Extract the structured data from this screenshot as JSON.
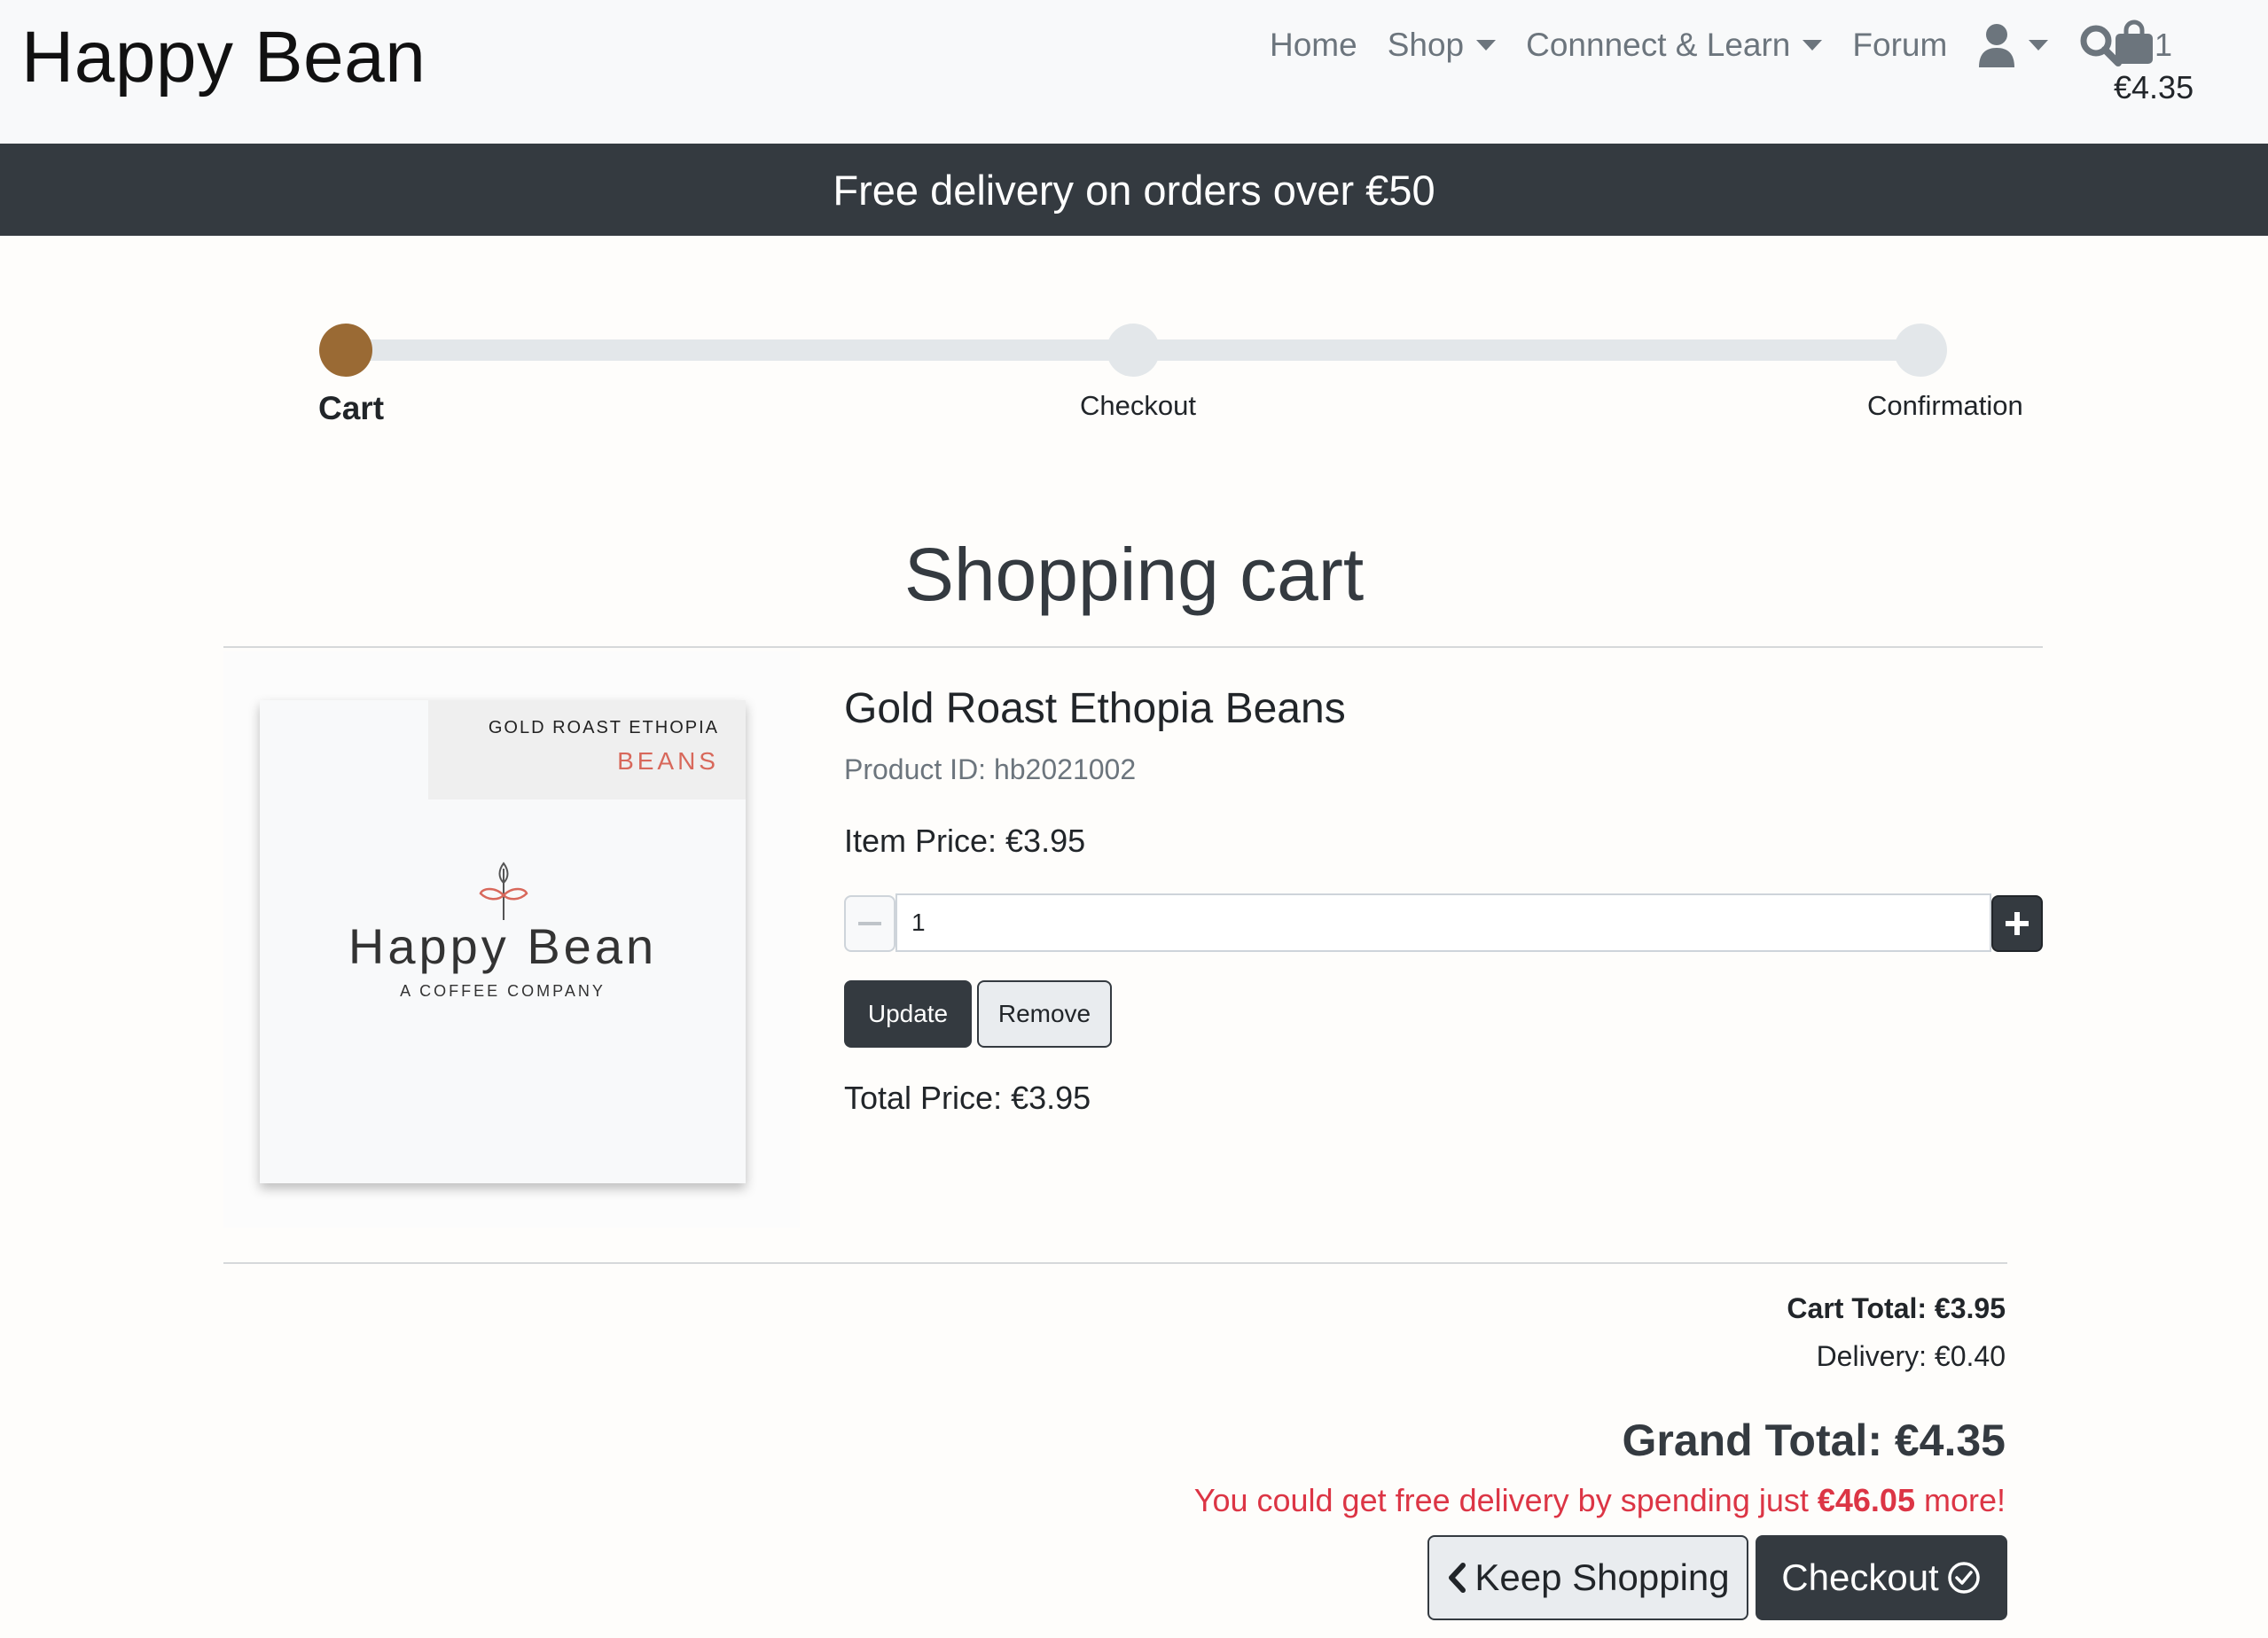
{
  "header": {
    "brand": "Happy Bean",
    "nav": {
      "home": "Home",
      "shop": "Shop",
      "connect": "Connnect & Learn",
      "forum": "Forum"
    },
    "cart": {
      "count": "1",
      "total": "€4.35"
    }
  },
  "banner": {
    "text": "Free delivery on orders over €50"
  },
  "progress": {
    "steps": [
      "Cart",
      "Checkout",
      "Confirmation"
    ],
    "active_color": "#9a6a34"
  },
  "page_title": "Shopping cart",
  "product": {
    "image": {
      "tag_top": "GOLD ROAST ETHOPIA",
      "tag_bottom": "BEANS",
      "logo": "Happy Bean",
      "subtitle": "A COFFEE COMPANY"
    },
    "name": "Gold Roast Ethopia Beans",
    "product_id": "Product ID: hb2021002",
    "item_price": "Item Price: €3.95",
    "quantity": "1",
    "update_label": "Update",
    "remove_label": "Remove",
    "total_price": "Total Price: €3.95"
  },
  "summary": {
    "cart_total": "Cart Total: €3.95",
    "delivery": "Delivery: €0.40",
    "grand_total": "Grand Total: €4.35",
    "free_prefix": "You could get free delivery by spending just ",
    "free_amount": "€46.05",
    "free_suffix": " more!"
  },
  "actions": {
    "keep_shopping": "Keep Shopping",
    "checkout": "Checkout"
  },
  "icons": {
    "user": "user-icon",
    "search": "search-icon",
    "bag": "shopping-bag-icon",
    "chevron_left": "chevron-left-icon",
    "check_circle": "check-circle-icon",
    "minus": "minus-icon",
    "plus": "plus-icon"
  }
}
